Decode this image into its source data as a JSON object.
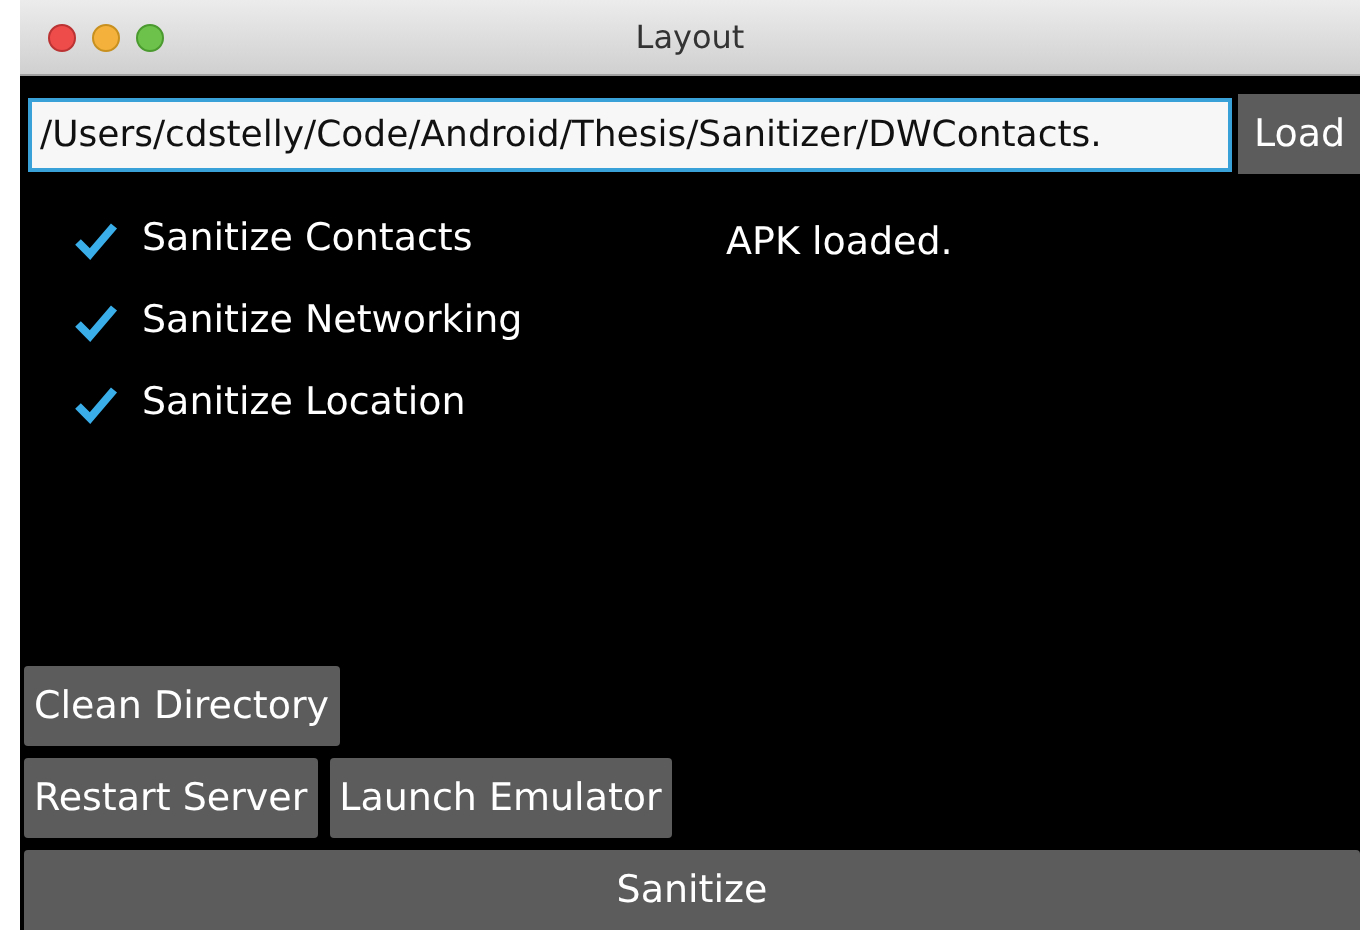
{
  "window": {
    "title": "Layout"
  },
  "path_field": {
    "value": "/Users/cdstelly/Code/Android/Thesis/Sanitizer/DWContacts."
  },
  "load_button": "Load",
  "options": [
    {
      "label": "Sanitize Contacts",
      "checked": true
    },
    {
      "label": "Sanitize Networking",
      "checked": true
    },
    {
      "label": "Sanitize Location",
      "checked": true
    }
  ],
  "status": "APK loaded.",
  "buttons": [
    [
      "Clean Directory"
    ],
    [
      "Restart Server",
      "Launch Emulator"
    ]
  ],
  "sanitize_button": "Sanitize"
}
